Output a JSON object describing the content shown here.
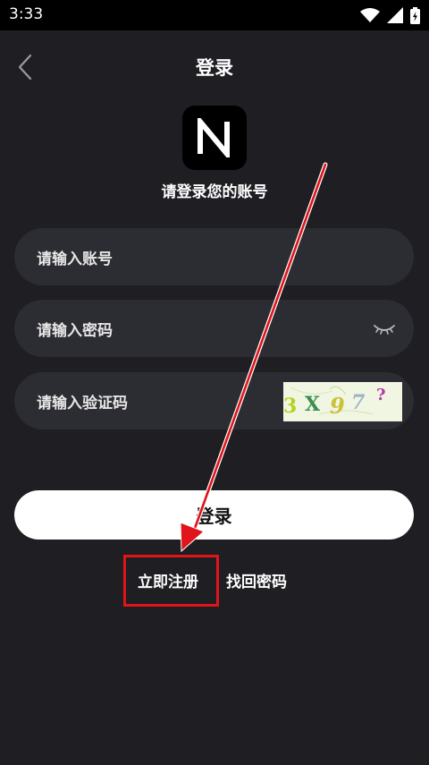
{
  "status_bar": {
    "time": "3:33"
  },
  "header": {
    "title": "登录",
    "back_icon": "chevron-left-icon"
  },
  "logo": {
    "icon": "n-logo-icon"
  },
  "subtitle": "请登录您的账号",
  "form": {
    "account_placeholder": "请输入账号",
    "password_placeholder": "请输入密码",
    "captcha_placeholder": "请输入验证码",
    "captcha_chars": [
      "3",
      "X",
      "9",
      "7",
      "?"
    ]
  },
  "login_button": "登录",
  "links": {
    "register": "立即注册",
    "forgot": "找回密码"
  },
  "colors": {
    "background": "#1e1e23",
    "field": "#2c2c33",
    "annotation": "#e0141a"
  }
}
